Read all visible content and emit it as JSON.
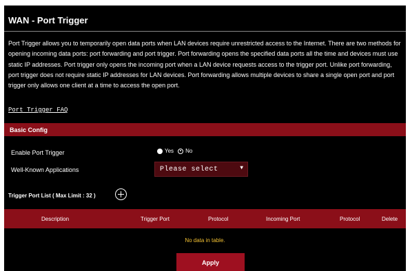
{
  "page": {
    "title": "WAN - Port Trigger",
    "description": "Port Trigger allows you to temporarily open data ports when LAN devices require unrestricted access to the Internet. There are two methods for opening incoming data ports: port forwarding and port trigger. Port forwarding opens the specified data ports all the time and devices must use static IP addresses. Port trigger only opens the incoming port when a LAN device requests access to the trigger port. Unlike port forwarding, port trigger does not require static IP addresses for LAN devices. Port forwarding allows multiple devices to share a single open port and port trigger only allows one client at a time to access the open port.",
    "faq_link": "Port Trigger FAQ"
  },
  "basic_config": {
    "header": "Basic Config",
    "enable_label": "Enable Port Trigger",
    "yes_label": "Yes",
    "no_label": "No",
    "enabled": "Yes",
    "apps_label": "Well-Known Applications",
    "apps_selected": "Please select"
  },
  "trigger_list": {
    "title": "Trigger Port List ( Max Limit : 32 )",
    "columns": [
      "Description",
      "Trigger Port",
      "Protocol",
      "Incoming Port",
      "Protocol",
      "Delete"
    ],
    "empty_text": "No data in table."
  },
  "actions": {
    "apply": "Apply"
  },
  "colors": {
    "accent": "#8b0f19",
    "background": "#000000",
    "empty_text": "#f2c033"
  }
}
